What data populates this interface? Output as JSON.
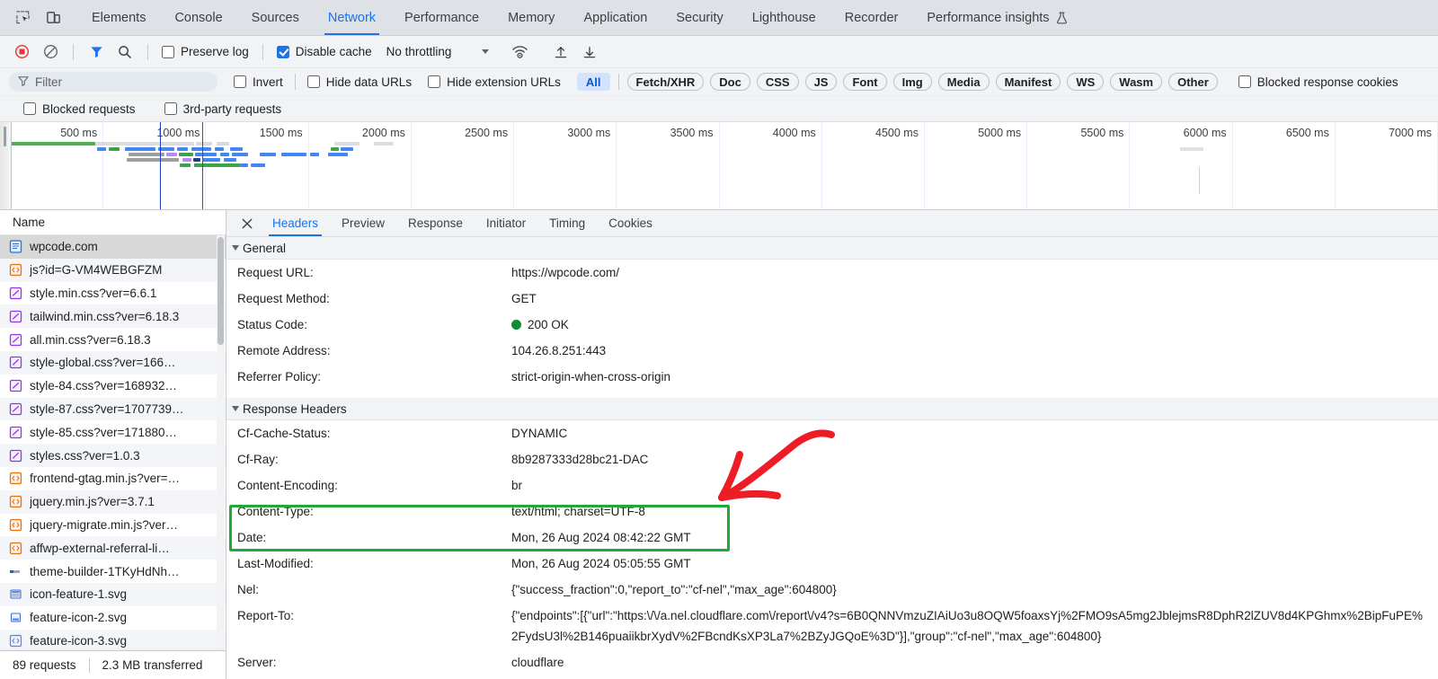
{
  "devtools": {
    "tabs": [
      {
        "label": "Elements",
        "active": false
      },
      {
        "label": "Console",
        "active": false
      },
      {
        "label": "Sources",
        "active": false
      },
      {
        "label": "Network",
        "active": true
      },
      {
        "label": "Performance",
        "active": false
      },
      {
        "label": "Memory",
        "active": false
      },
      {
        "label": "Application",
        "active": false
      },
      {
        "label": "Security",
        "active": false
      },
      {
        "label": "Lighthouse",
        "active": false
      },
      {
        "label": "Recorder",
        "active": false
      },
      {
        "label": "Performance insights",
        "active": false
      }
    ],
    "inspect_icon": "inspect-element-icon",
    "device_icon": "device-toolbar-icon",
    "flask_icon": "flask-experimental-icon"
  },
  "toolbar": {
    "record_icon": "record-stop-icon",
    "clear_icon": "clear-network-log-icon",
    "filter_icon": "filter-icon",
    "search_icon": "search-icon",
    "preserve_log_label": "Preserve log",
    "preserve_log_checked": false,
    "disable_cache_label": "Disable cache",
    "disable_cache_checked": true,
    "throttling_value": "No throttling",
    "wifi_icon": "network-conditions-icon",
    "import_icon": "import-har-icon",
    "export_icon": "export-har-icon"
  },
  "filters": {
    "filter_placeholder": "Filter",
    "invert_label": "Invert",
    "invert_checked": false,
    "hide_data_urls_label": "Hide data URLs",
    "hide_data_urls_checked": false,
    "hide_extension_urls_label": "Hide extension URLs",
    "hide_extension_urls_checked": false,
    "types": [
      {
        "label": "All",
        "active": true
      },
      {
        "label": "Fetch/XHR",
        "active": false
      },
      {
        "label": "Doc",
        "active": false
      },
      {
        "label": "CSS",
        "active": false
      },
      {
        "label": "JS",
        "active": false
      },
      {
        "label": "Font",
        "active": false
      },
      {
        "label": "Img",
        "active": false
      },
      {
        "label": "Media",
        "active": false
      },
      {
        "label": "Manifest",
        "active": false
      },
      {
        "label": "WS",
        "active": false
      },
      {
        "label": "Wasm",
        "active": false
      },
      {
        "label": "Other",
        "active": false
      }
    ],
    "blocked_response_cookies_label": "Blocked response cookies",
    "blocked_response_cookies_checked": false,
    "blocked_requests_label": "Blocked requests",
    "blocked_requests_checked": false,
    "third_party_requests_label": "3rd-party requests",
    "third_party_requests_checked": false
  },
  "overview": {
    "ticks": [
      "500 ms",
      "1000 ms",
      "1500 ms",
      "2000 ms",
      "2500 ms",
      "3000 ms",
      "3500 ms",
      "4000 ms",
      "4500 ms",
      "5000 ms",
      "5500 ms",
      "6000 ms",
      "6500 ms",
      "7000 ms"
    ],
    "dcl_color": "#1a3fbf",
    "load_color": "#c5221f"
  },
  "request_list": {
    "column_header": "Name",
    "items": [
      {
        "name": "wpcode.com",
        "type": "doc",
        "selected": true
      },
      {
        "name": "js?id=G-VM4WEBGFZM",
        "type": "js",
        "selected": false
      },
      {
        "name": "style.min.css?ver=6.6.1",
        "type": "css",
        "selected": false
      },
      {
        "name": "tailwind.min.css?ver=6.18.3",
        "type": "css",
        "selected": false
      },
      {
        "name": "all.min.css?ver=6.18.3",
        "type": "css",
        "selected": false
      },
      {
        "name": "style-global.css?ver=166…",
        "type": "css",
        "selected": false
      },
      {
        "name": "style-84.css?ver=168932…",
        "type": "css",
        "selected": false
      },
      {
        "name": "style-87.css?ver=1707739…",
        "type": "css",
        "selected": false
      },
      {
        "name": "style-85.css?ver=171880…",
        "type": "css",
        "selected": false
      },
      {
        "name": "styles.css?ver=1.0.3",
        "type": "css",
        "selected": false
      },
      {
        "name": "frontend-gtag.min.js?ver=…",
        "type": "js",
        "selected": false
      },
      {
        "name": "jquery.min.js?ver=3.7.1",
        "type": "js",
        "selected": false
      },
      {
        "name": "jquery-migrate.min.js?ver…",
        "type": "js",
        "selected": false
      },
      {
        "name": "affwp-external-referral-li…",
        "type": "js",
        "selected": false
      },
      {
        "name": "theme-builder-1TKyHdNh…",
        "type": "img",
        "selected": false
      },
      {
        "name": "icon-feature-1.svg",
        "type": "svg",
        "selected": false
      },
      {
        "name": "feature-icon-2.svg",
        "type": "svg",
        "selected": false
      },
      {
        "name": "feature-icon-3.svg",
        "type": "svg",
        "selected": false
      }
    ]
  },
  "status_bar": {
    "requests": "89 requests",
    "transferred": "2.3 MB transferred"
  },
  "detail": {
    "close_icon": "close-icon",
    "tabs": [
      {
        "label": "Headers",
        "active": true
      },
      {
        "label": "Preview",
        "active": false
      },
      {
        "label": "Response",
        "active": false
      },
      {
        "label": "Initiator",
        "active": false
      },
      {
        "label": "Timing",
        "active": false
      },
      {
        "label": "Cookies",
        "active": false
      }
    ],
    "general_section_title": "General",
    "general": [
      {
        "key": "Request URL:",
        "value": "https://wpcode.com/"
      },
      {
        "key": "Request Method:",
        "value": "GET"
      },
      {
        "key": "Status Code:",
        "value": "200 OK",
        "status_dot": true
      },
      {
        "key": "Remote Address:",
        "value": "104.26.8.251:443"
      },
      {
        "key": "Referrer Policy:",
        "value": "strict-origin-when-cross-origin"
      }
    ],
    "response_section_title": "Response Headers",
    "response_headers": [
      {
        "key": "Cf-Cache-Status:",
        "value": "DYNAMIC"
      },
      {
        "key": "Cf-Ray:",
        "value": "8b9287333d28bc21-DAC"
      },
      {
        "key": "Content-Encoding:",
        "value": "br"
      },
      {
        "key": "Content-Type:",
        "value": "text/html; charset=UTF-8"
      },
      {
        "key": "Date:",
        "value": "Mon, 26 Aug 2024 08:42:22 GMT",
        "highlighted": true
      },
      {
        "key": "Last-Modified:",
        "value": "Mon, 26 Aug 2024 05:05:55 GMT",
        "highlighted": true
      },
      {
        "key": "Nel:",
        "value": "{\"success_fraction\":0,\"report_to\":\"cf-nel\",\"max_age\":604800}"
      },
      {
        "key": "Report-To:",
        "value": "{\"endpoints\":[{\"url\":\"https:\\/\\/a.nel.cloudflare.com\\/report\\/v4?s=6B0QNNVmzuZIAiUo3u8OQW5foaxsYj%2FMO9sA5mg2JblejmsR8DphR2lZUV8d4KPGhmx%2BipFuPE%2FydsU3l%2B146puaiikbrXydV%2FBcndKsXP3La7%2BZyJGQoE%3D\"}],\"group\":\"cf-nel\",\"max_age\":604800}"
      },
      {
        "key": "Server:",
        "value": "cloudflare"
      }
    ]
  },
  "annotations": {
    "highlight_color": "#1eaa34",
    "arrow_color": "#ee1c25"
  }
}
